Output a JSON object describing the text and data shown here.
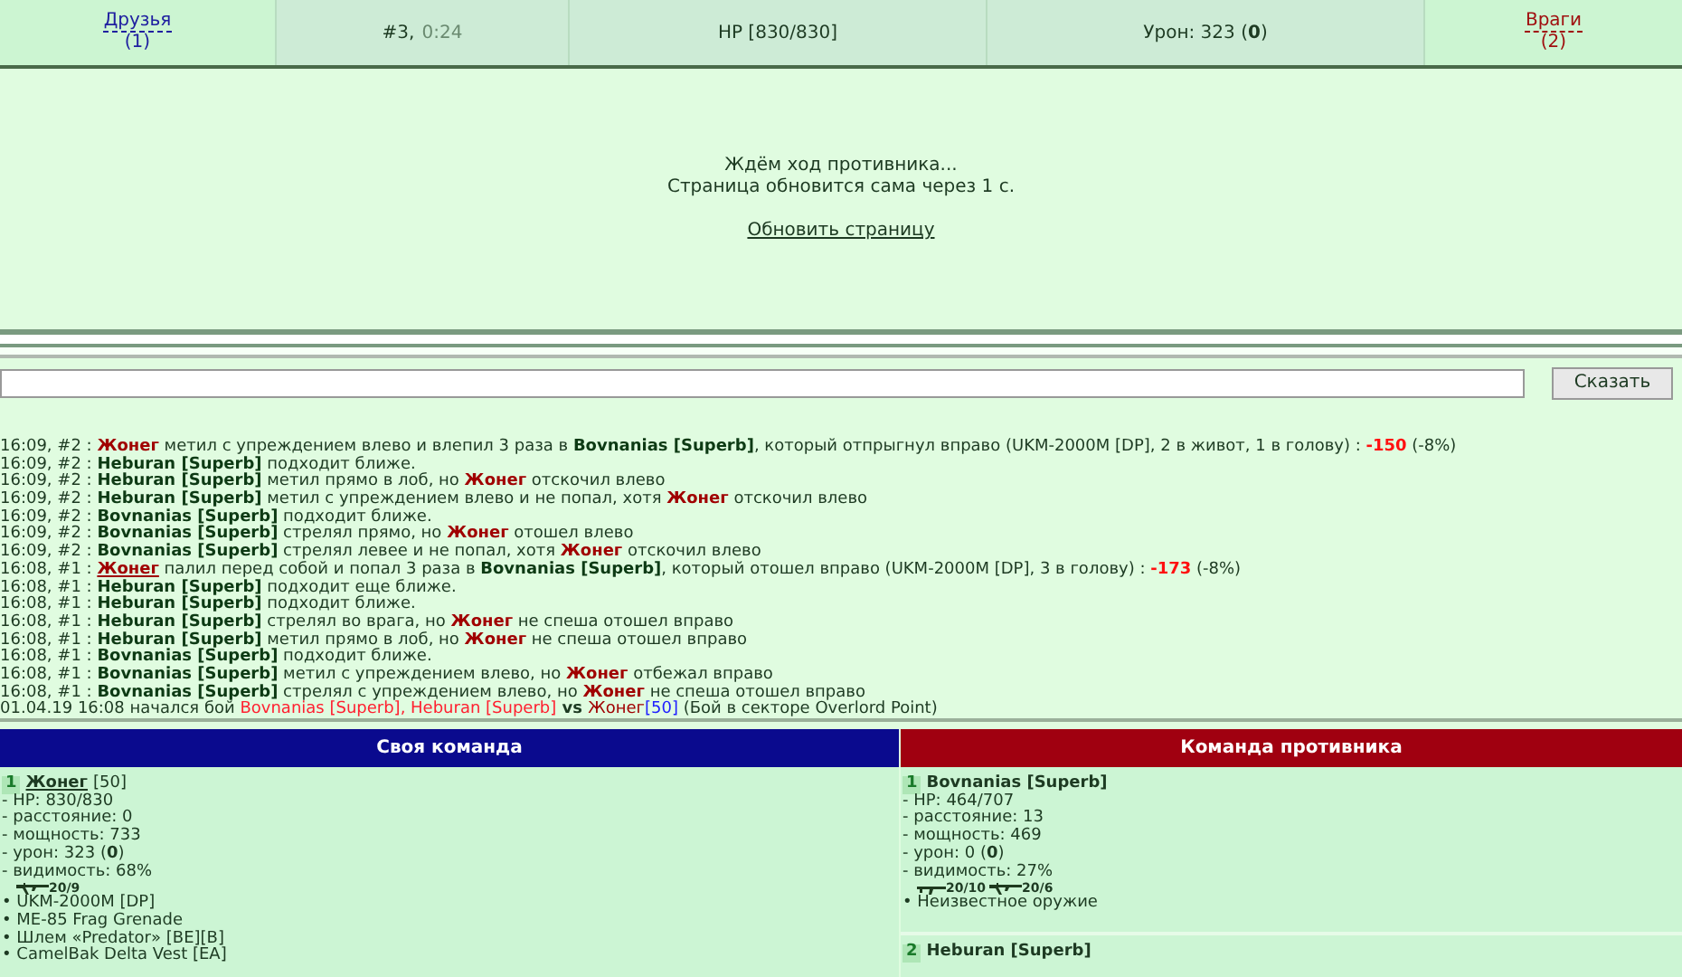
{
  "top_bar": {
    "friends": {
      "label": "Друзья",
      "count": "(1)"
    },
    "turn": {
      "number": "#3,",
      "time": "0:24"
    },
    "hp": "HP [830/830]",
    "damage": "Урон: 323 (**0**)",
    "enemies": {
      "label": "Враги",
      "count": "(2)"
    }
  },
  "waiting": {
    "lines": [
      "Ждём ход противника...",
      "Страница обновится сама через 1 с."
    ],
    "refresh_link": "Обновить страницу"
  },
  "chat": {
    "button": "Сказать"
  },
  "log": [
    [
      {
        "kind": "text",
        "text": "16:09, #2 : "
      },
      {
        "kind": "self",
        "text": "Жонег"
      },
      {
        "kind": "text",
        "text": " метил с упреждением влево и влепил 3 раза в "
      },
      {
        "kind": "enemy",
        "text": "Bovnanias [Superb]"
      },
      {
        "kind": "text",
        "text": ", который отпрыгнул вправо (UKM-2000M [DP], 2 в живот, 1 в голову) : "
      },
      {
        "kind": "dmg",
        "text": "-150"
      },
      {
        "kind": "text",
        "text": " (-8%)"
      }
    ],
    [
      {
        "kind": "text",
        "text": "16:09, #2 : "
      },
      {
        "kind": "enemy",
        "text": "Heburan [Superb]"
      },
      {
        "kind": "text",
        "text": " подходит ближе."
      }
    ],
    [
      {
        "kind": "text",
        "text": "16:09, #2 : "
      },
      {
        "kind": "enemy",
        "text": "Heburan [Superb]"
      },
      {
        "kind": "text",
        "text": " метил прямо в лоб, но "
      },
      {
        "kind": "self",
        "text": "Жонег"
      },
      {
        "kind": "text",
        "text": " отскочил влево"
      }
    ],
    [
      {
        "kind": "text",
        "text": "16:09, #2 : "
      },
      {
        "kind": "enemy",
        "text": "Heburan [Superb]"
      },
      {
        "kind": "text",
        "text": " метил с упреждением влево и не попал, хотя "
      },
      {
        "kind": "self",
        "text": "Жонег"
      },
      {
        "kind": "text",
        "text": " отскочил влево"
      }
    ],
    [
      {
        "kind": "text",
        "text": "16:09, #2 : "
      },
      {
        "kind": "enemy",
        "text": "Bovnanias [Superb]"
      },
      {
        "kind": "text",
        "text": " подходит ближе."
      }
    ],
    [
      {
        "kind": "text",
        "text": "16:09, #2 : "
      },
      {
        "kind": "enemy",
        "text": "Bovnanias [Superb]"
      },
      {
        "kind": "text",
        "text": " стрелял прямо, но "
      },
      {
        "kind": "self",
        "text": "Жонег"
      },
      {
        "kind": "text",
        "text": " отошел влево"
      }
    ],
    [
      {
        "kind": "text",
        "text": "16:09, #2 : "
      },
      {
        "kind": "enemy",
        "text": "Bovnanias [Superb]"
      },
      {
        "kind": "text",
        "text": " стрелял левее и не попал, хотя "
      },
      {
        "kind": "self",
        "text": "Жонег"
      },
      {
        "kind": "text",
        "text": " отскочил влево"
      }
    ],
    [
      {
        "kind": "text",
        "text": "16:08, #1 : "
      },
      {
        "kind": "self_link",
        "text": "Жонег"
      },
      {
        "kind": "text",
        "text": " палил перед собой и попал 3 раза в "
      },
      {
        "kind": "enemy",
        "text": "Bovnanias [Superb]"
      },
      {
        "kind": "text",
        "text": ", который отошел вправо (UKM-2000M [DP], 3 в голову) : "
      },
      {
        "kind": "dmg",
        "text": "-173"
      },
      {
        "kind": "text",
        "text": " (-8%)"
      }
    ],
    [
      {
        "kind": "text",
        "text": "16:08, #1 : "
      },
      {
        "kind": "enemy",
        "text": "Heburan [Superb]"
      },
      {
        "kind": "text",
        "text": " подходит еще ближе."
      }
    ],
    [
      {
        "kind": "text",
        "text": "16:08, #1 : "
      },
      {
        "kind": "enemy",
        "text": "Heburan [Superb]"
      },
      {
        "kind": "text",
        "text": " подходит ближе."
      }
    ],
    [
      {
        "kind": "text",
        "text": "16:08, #1 : "
      },
      {
        "kind": "enemy",
        "text": "Heburan [Superb]"
      },
      {
        "kind": "text",
        "text": " стрелял во врага, но "
      },
      {
        "kind": "self",
        "text": "Жонег"
      },
      {
        "kind": "text",
        "text": " не спеша отошел вправо"
      }
    ],
    [
      {
        "kind": "text",
        "text": "16:08, #1 : "
      },
      {
        "kind": "enemy",
        "text": "Heburan [Superb]"
      },
      {
        "kind": "text",
        "text": " метил прямо в лоб, но "
      },
      {
        "kind": "self",
        "text": "Жонег"
      },
      {
        "kind": "text",
        "text": " не спеша отошел вправо"
      }
    ],
    [
      {
        "kind": "text",
        "text": "16:08, #1 : "
      },
      {
        "kind": "enemy",
        "text": "Bovnanias [Superb]"
      },
      {
        "kind": "text",
        "text": " подходит ближе."
      }
    ],
    [
      {
        "kind": "text",
        "text": "16:08, #1 : "
      },
      {
        "kind": "enemy",
        "text": "Bovnanias [Superb]"
      },
      {
        "kind": "text",
        "text": " метил с упреждением влево, но "
      },
      {
        "kind": "self",
        "text": "Жонег"
      },
      {
        "kind": "text",
        "text": " отбежал вправо"
      }
    ],
    [
      {
        "kind": "text",
        "text": "16:08, #1 : "
      },
      {
        "kind": "enemy",
        "text": "Bovnanias [Superb]"
      },
      {
        "kind": "text",
        "text": " стрелял с упреждением влево, но "
      },
      {
        "kind": "self",
        "text": "Жонег"
      },
      {
        "kind": "text",
        "text": " не спеша отошел вправо"
      }
    ],
    [
      {
        "kind": "text",
        "text": "01.04.19 16:08 начался бой "
      },
      {
        "kind": "red",
        "text": "Bovnanias [Superb], Heburan [Superb]"
      },
      {
        "kind": "bold",
        "text": " vs "
      },
      {
        "kind": "darkred",
        "text": "Жонег"
      },
      {
        "kind": "blue",
        "text": "[50]"
      },
      {
        "kind": "text",
        "text": " (Бой в секторе Overlord Point)"
      }
    ]
  ],
  "teams": [
    {
      "title": "Своя команда",
      "color": "#0a0a8e",
      "members": [
        {
          "number": "1",
          "name": "Жонег",
          "level": "[50]",
          "stats": [
            "- HP: 830/830",
            "- расстояние: 0",
            "- мощность: 733",
            "- урон: 323 (**0**)",
            "- видимость: 68%"
          ],
          "weapons": [
            {
              "kind": "rifle",
              "ammo": "20/9"
            }
          ],
          "items": [
            "• UKM-2000M [DP]",
            "• ME-85 Frag Grenade",
            "• Шлем «Predator» [BE][B]",
            "• CamelBak Delta Vest [EA]"
          ]
        }
      ]
    },
    {
      "title": "Команда противника",
      "color": "#a00010",
      "members": [
        {
          "number": "1",
          "name": "Bovnanias [Superb]",
          "stats": [
            "- HP: 464/707",
            "- расстояние: 13",
            "- мощность: 469",
            "- урон: 0 (**0**)",
            "- видимость: 27%"
          ],
          "weapons": [
            {
              "kind": "smg",
              "ammo": "20/10"
            },
            {
              "kind": "rifle",
              "ammo": "20/6"
            }
          ],
          "items": [
            "• Неизвестное оружие"
          ]
        },
        {
          "number": "2",
          "name": "Heburan [Superb]"
        }
      ]
    }
  ]
}
